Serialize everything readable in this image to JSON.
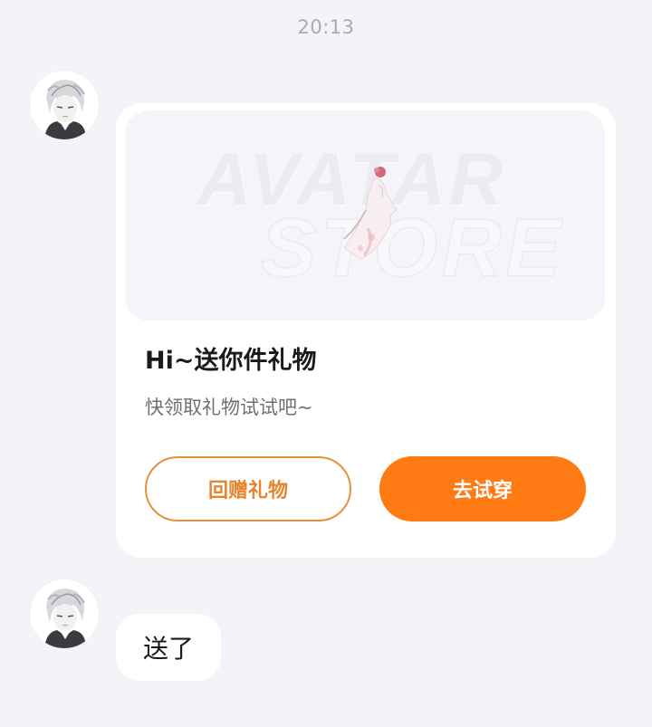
{
  "chat": {
    "timestamp": "20:13",
    "gift_card": {
      "banner_word_top": "AVATAR",
      "banner_word_bottom": "STORE",
      "title": "Hi~送你件礼物",
      "subtitle": "快领取礼物试试吧~",
      "return_gift_label": "回赠礼物",
      "try_on_label": "去试穿"
    },
    "reply_message": "送了"
  },
  "colors": {
    "background": "#f4f4f8",
    "card": "#ffffff",
    "accent_orange": "#ff7a12",
    "outline_orange": "#e6913c",
    "timestamp_gray": "#a9a9b1"
  },
  "icons": {
    "avatar": "anime-character-avatar-icon",
    "banner_figure": "dress-icon"
  }
}
